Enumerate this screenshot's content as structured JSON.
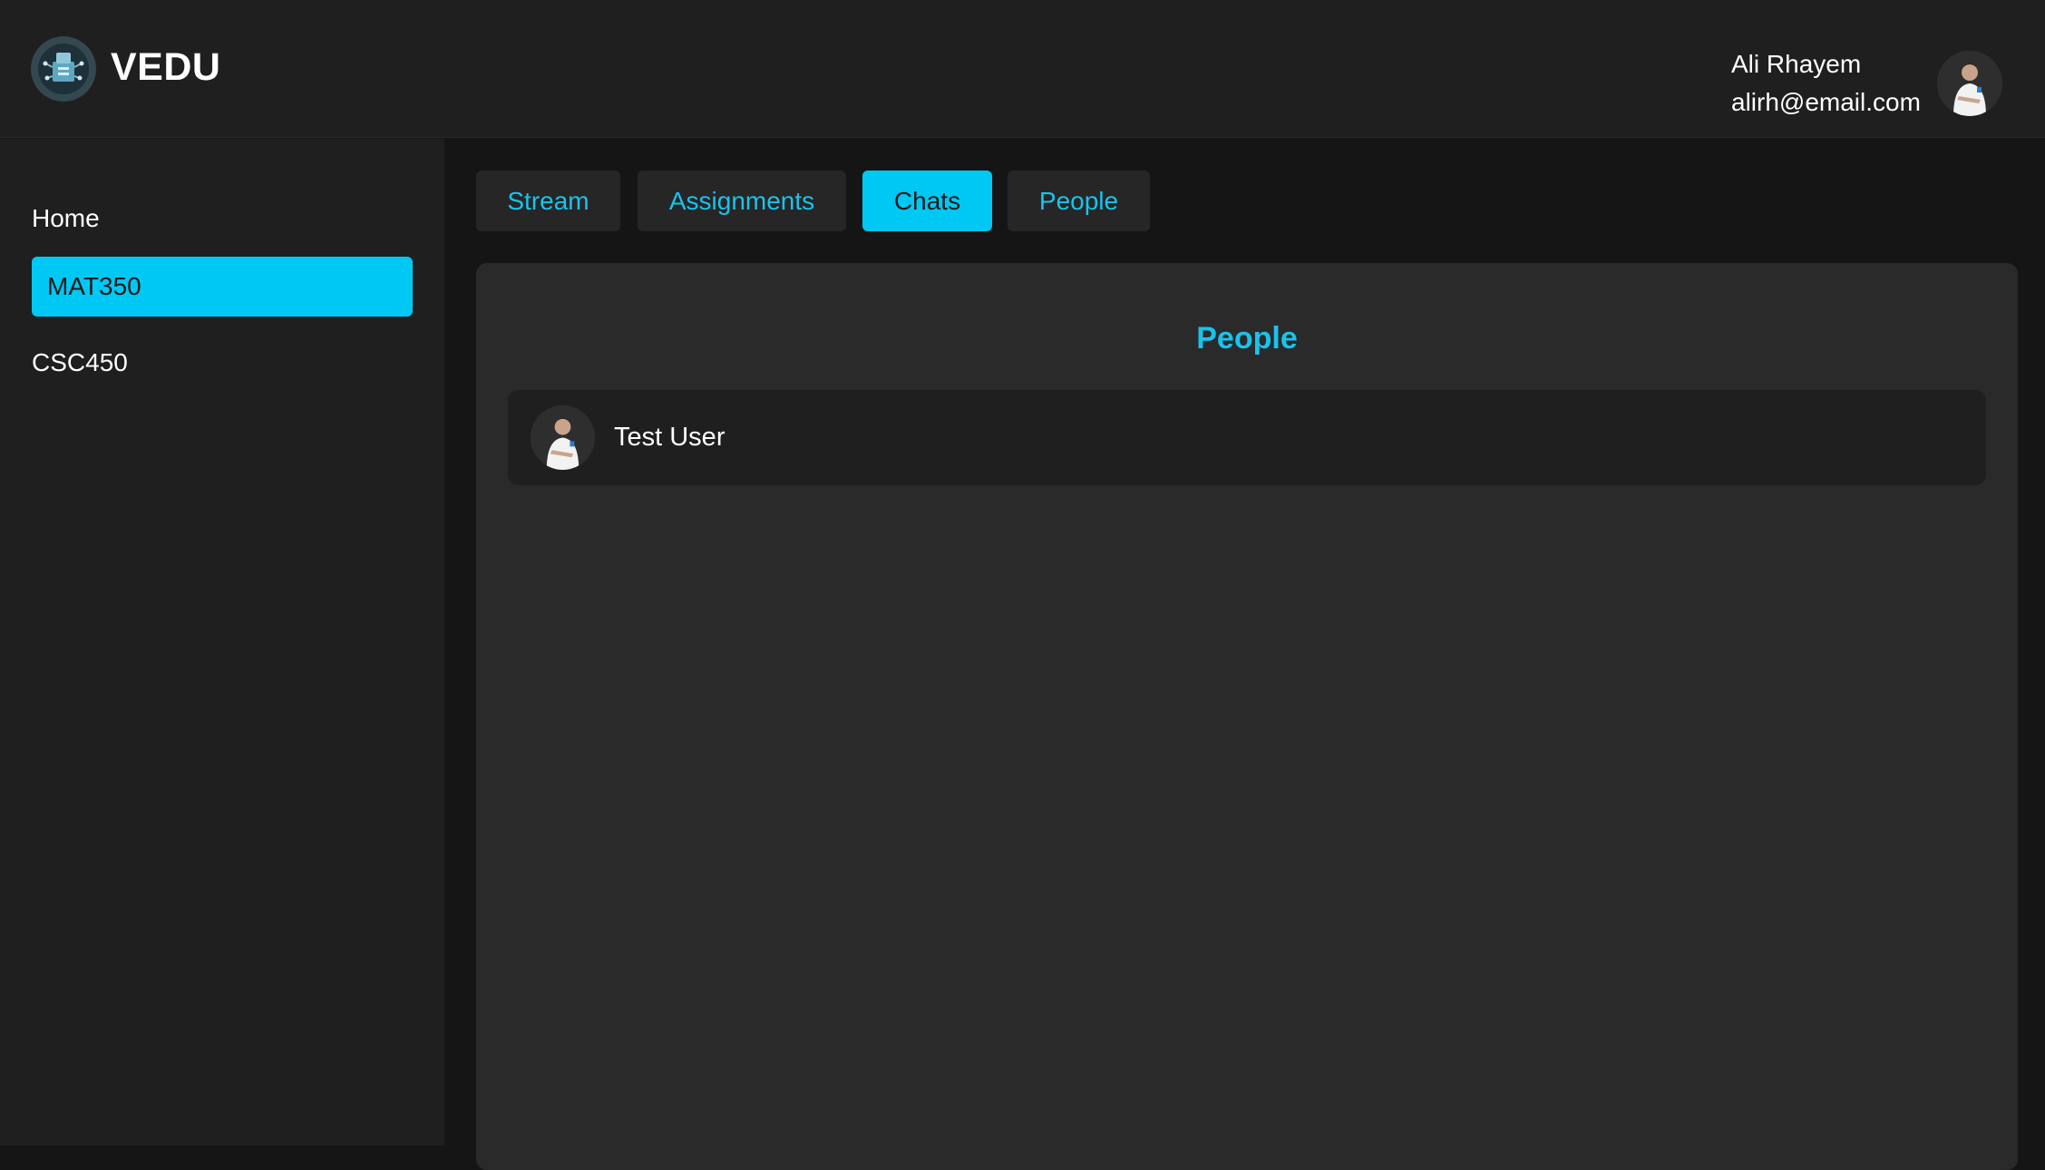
{
  "header": {
    "app_name": "VEDU",
    "user_name": "Ali Rhayem",
    "user_email": "alirh@email.com"
  },
  "sidebar": {
    "items": [
      {
        "label": "Home",
        "active": false
      },
      {
        "label": "MAT350",
        "active": true
      },
      {
        "label": "CSC450",
        "active": false
      }
    ]
  },
  "tabs": [
    {
      "label": "Stream",
      "active": false
    },
    {
      "label": "Assignments",
      "active": false
    },
    {
      "label": "Chats",
      "active": true
    },
    {
      "label": "People",
      "active": false
    }
  ],
  "panel": {
    "title": "People",
    "people": [
      {
        "name": "Test User"
      }
    ]
  },
  "colors": {
    "accent": "#00c8f5",
    "background": "#151515",
    "surface": "#1f1f1f",
    "panel": "#2a2a2a"
  }
}
